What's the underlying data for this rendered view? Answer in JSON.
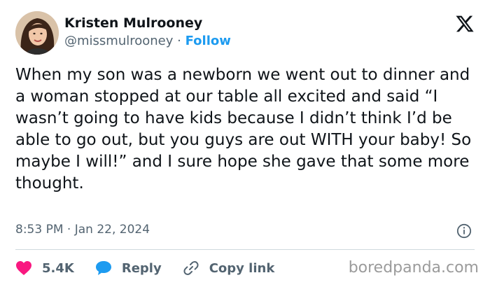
{
  "author": {
    "name": "Kristen Mulrooney",
    "handle": "@missmulrooney",
    "separator": "·",
    "follow_label": "Follow"
  },
  "tweet": {
    "text": "When my son was a newborn we went out to dinner and a woman stopped at our table all excited and said “I wasn’t going to have kids because I didn’t think I’d be able to go out, but you guys are out WITH your baby! So maybe I will!” and I sure hope she gave that some more thought.",
    "timestamp": "8:53 PM · Jan 22, 2024"
  },
  "actions": {
    "like_count": "5.4K",
    "reply_label": "Reply",
    "copy_link_label": "Copy link"
  },
  "watermark": "boredpanda.com",
  "colors": {
    "like": "#f91880",
    "reply": "#1d9bf0",
    "follow": "#1d9bf0",
    "secondary_text": "#536471",
    "primary_text": "#0f1419"
  },
  "icons": [
    "x-logo-icon",
    "info-icon",
    "heart-icon",
    "speech-bubble-icon",
    "link-icon"
  ]
}
